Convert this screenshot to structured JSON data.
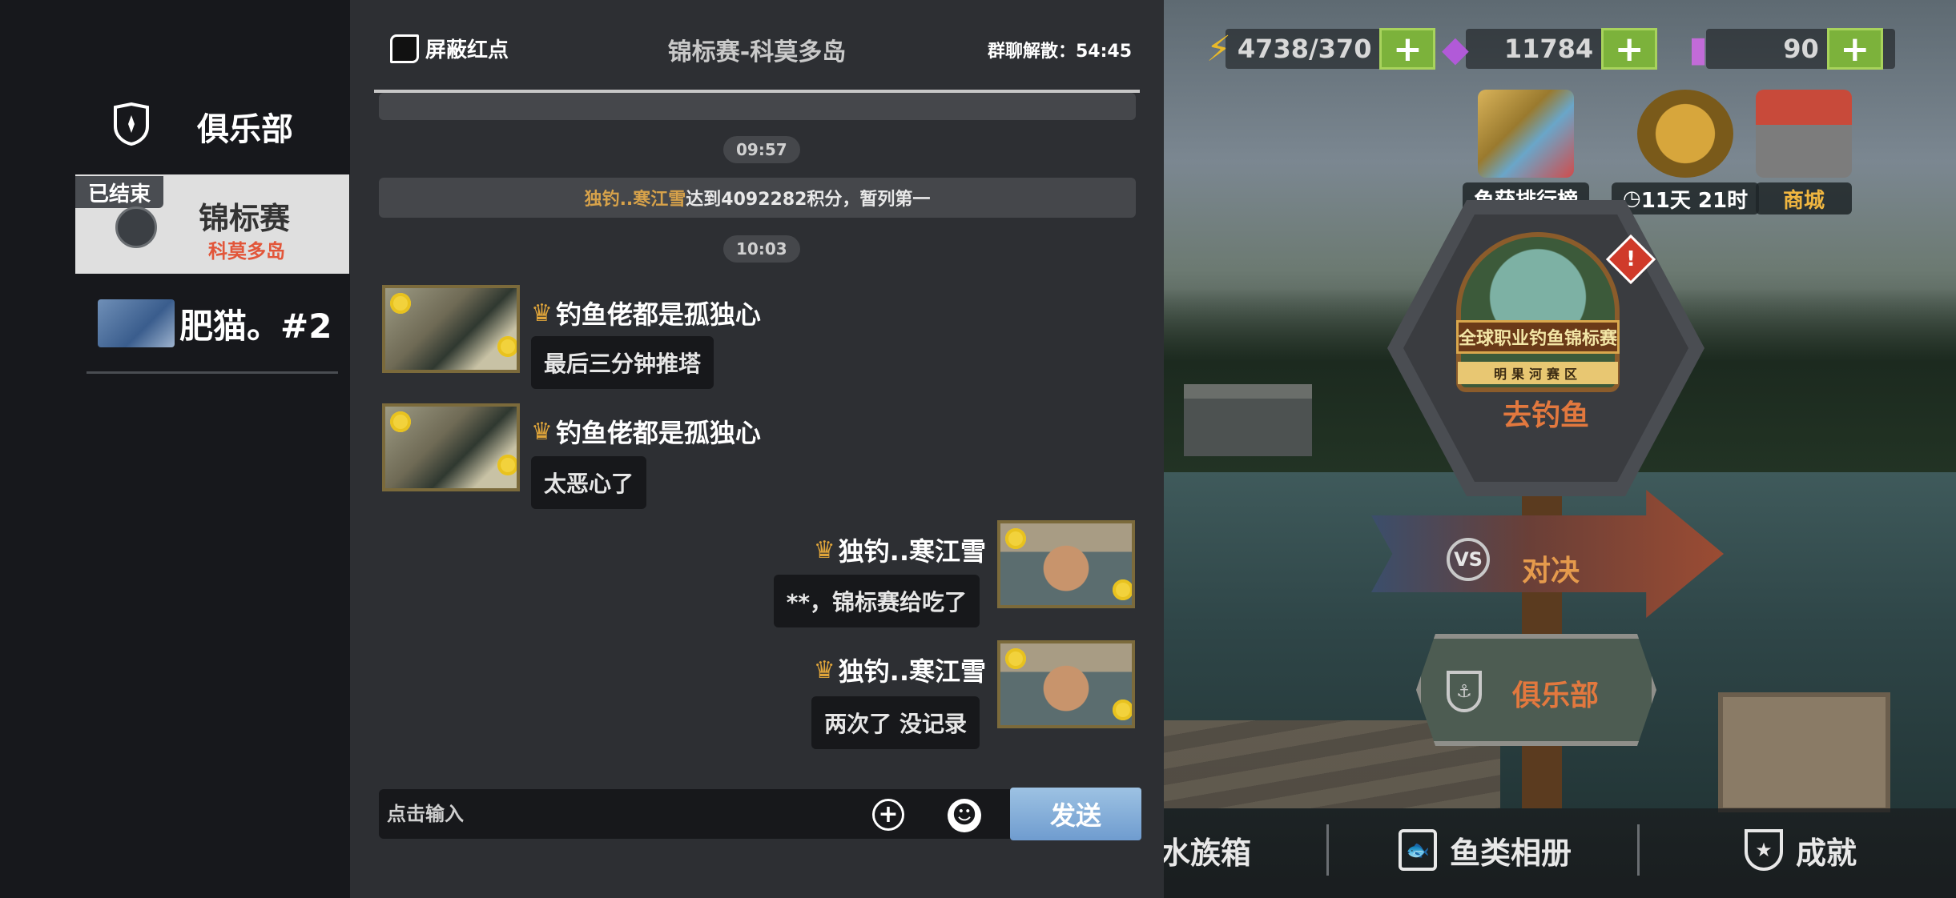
{
  "sidebar": {
    "club_title": "俱乐部",
    "active_item": {
      "badge": "已结束",
      "name": "锦标赛",
      "sub": "科莫多岛"
    },
    "second_item": {
      "label": "肥猫。#2"
    }
  },
  "chat": {
    "mute_label": "屏蔽红点",
    "title": "锦标赛-科莫多岛",
    "disband": "群聊解散：54:45",
    "time_1": "09:57",
    "system_message": {
      "who": "独钓..寒江雪",
      "text": "达到4092282积分，暂列第一"
    },
    "time_2": "10:03",
    "messages": [
      {
        "name": "钓鱼佬都是孤独心",
        "text": "最后三分钟推塔"
      },
      {
        "name": "钓鱼佬都是孤独心",
        "text": "太恶心了"
      },
      {
        "name": "独钓..寒江雪",
        "text": "**，锦标赛给吃了"
      },
      {
        "name": "独钓..寒江雪",
        "text": "两次了 没记录"
      }
    ],
    "input_placeholder": "点击输入",
    "send_label": "发送"
  },
  "resources": {
    "energy": "4738/370",
    "gems": "11784",
    "tickets": "90"
  },
  "top_icons": {
    "leaderboard": "鱼获排行榜",
    "event_timer": "11天 21时",
    "shop": "商城"
  },
  "signs": {
    "emblem_title": "全球职业钓鱼锦标赛",
    "emblem_sub": "明果河赛区",
    "go_fish": "去钓鱼",
    "duel": "对决",
    "club": "俱乐部"
  },
  "bottom_nav": {
    "aquarium": "水族箱",
    "album": "鱼类相册",
    "achievements": "成就"
  },
  "colors": {
    "accent_orange": "#e2783e",
    "plus_green": "#7cb23b",
    "send_blue": "#6f9ccf",
    "system_name_gold": "#d7a24a"
  }
}
